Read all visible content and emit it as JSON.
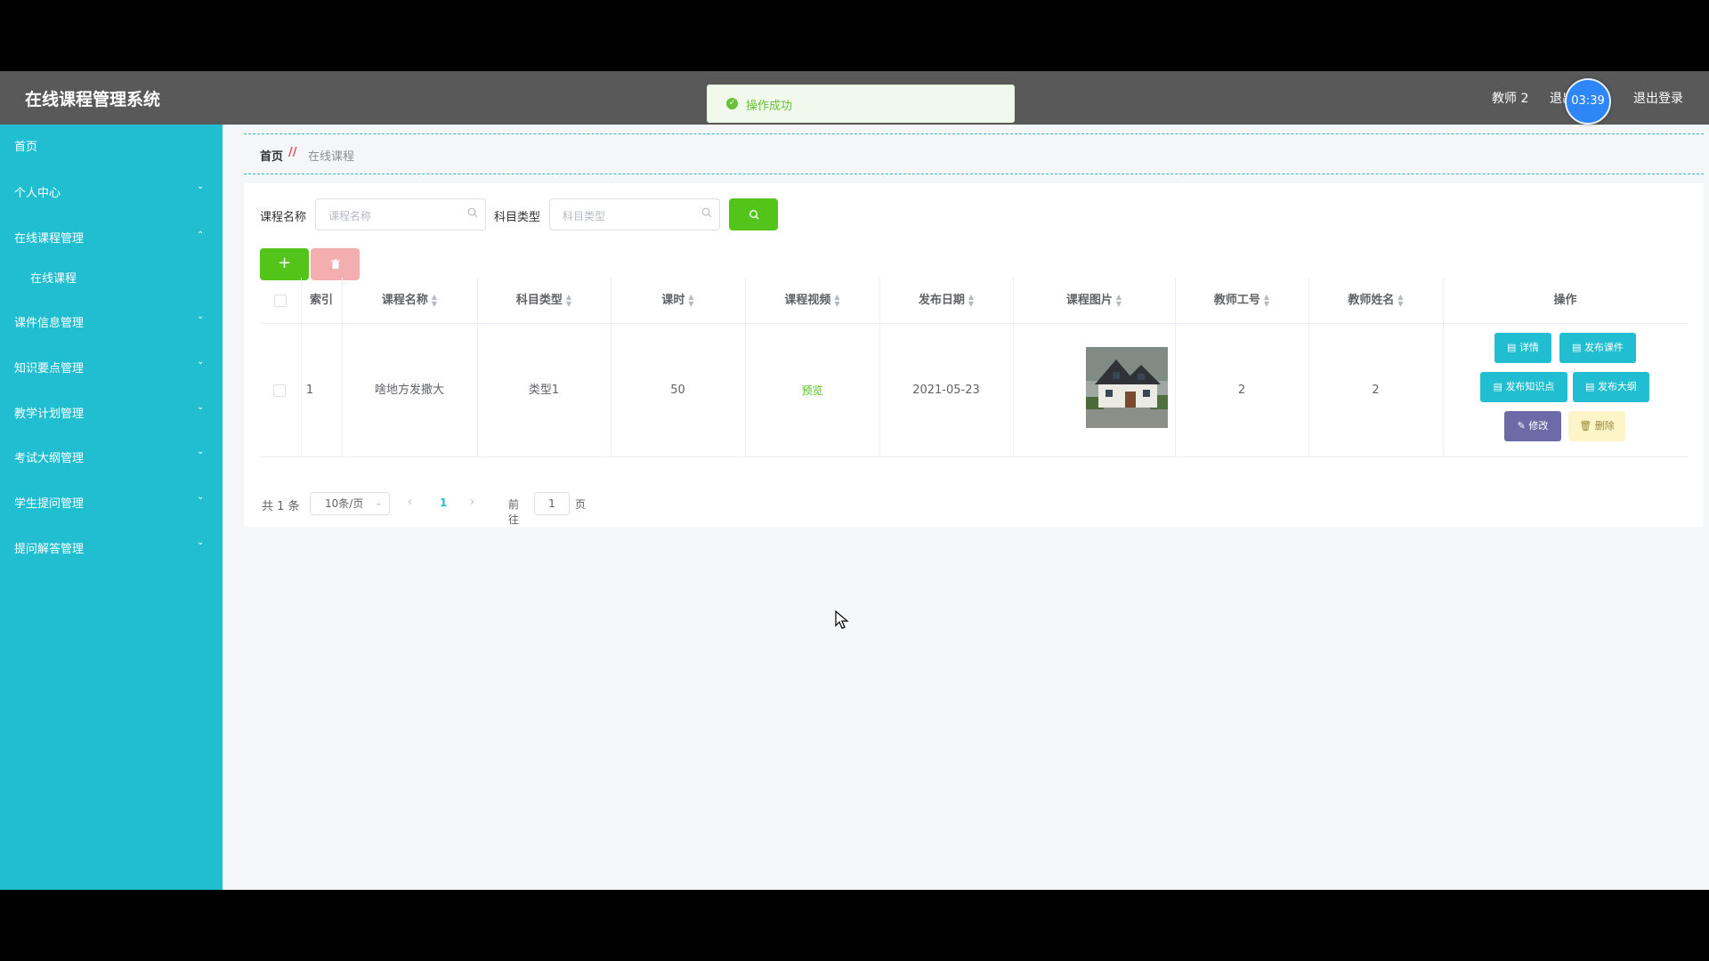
{
  "app": {
    "title": "在线课程管理系统",
    "user": "教师 2",
    "exit_fragment": "退出",
    "logout": "退出登录",
    "timer": "03:39"
  },
  "toast": {
    "message": "操作成功"
  },
  "sidebar": {
    "items": [
      {
        "label": "首页"
      },
      {
        "label": "个人中心"
      },
      {
        "label": "在线课程管理"
      },
      {
        "label": "在线课程"
      },
      {
        "label": "课件信息管理"
      },
      {
        "label": "知识要点管理"
      },
      {
        "label": "教学计划管理"
      },
      {
        "label": "考试大纲管理"
      },
      {
        "label": "学生提问管理"
      },
      {
        "label": "提问解答管理"
      }
    ]
  },
  "breadcrumb": {
    "home": "首页",
    "separator": "//",
    "current": "在线课程"
  },
  "search": {
    "course_label": "课程名称",
    "course_placeholder": "课程名称",
    "type_label": "科目类型",
    "type_placeholder": "科目类型"
  },
  "table": {
    "columns": [
      "索引",
      "课程名称",
      "科目类型",
      "课时",
      "课程视频",
      "发布日期",
      "课程图片",
      "教师工号",
      "教师姓名",
      "操作"
    ],
    "rows": [
      {
        "index": "1",
        "name": "啥地方发撒大",
        "type": "类型1",
        "hours": "50",
        "video": "预览",
        "date": "2021-05-23",
        "teacher_id": "2",
        "teacher_name": "2"
      }
    ],
    "actions": {
      "detail": "详情",
      "publish_courseware": "发布课件",
      "publish_knowledge": "发布知识点",
      "publish_outline": "发布大纲",
      "edit": "修改",
      "delete": "删除"
    }
  },
  "pagination": {
    "total": "共 1 条",
    "page_size": "10条/页",
    "current_page": "1",
    "goto_label": "前往",
    "goto_value": "1",
    "goto_suffix": "页"
  },
  "colors": {
    "sidebar": "#20bed0",
    "header": "#595959",
    "primary_green": "#52c41a",
    "toast_bg": "#f0f9eb"
  }
}
